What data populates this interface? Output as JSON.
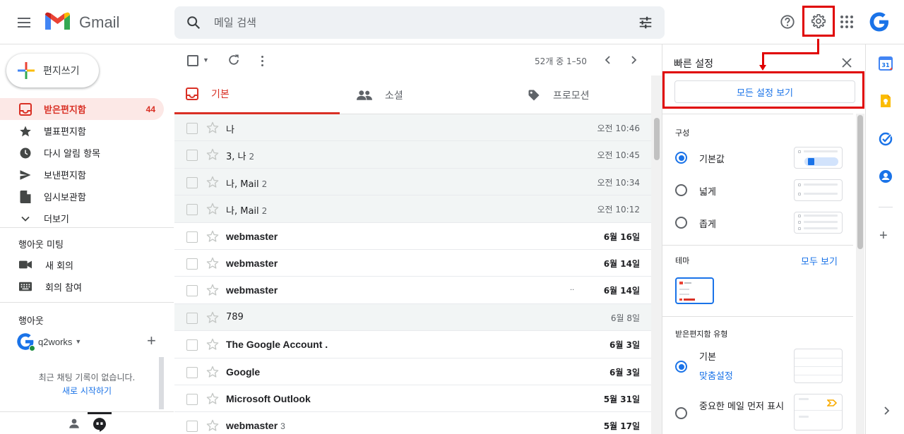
{
  "header": {
    "logo_text": "Gmail",
    "search_placeholder": "메일 검색",
    "account_letter": "G"
  },
  "sidebar": {
    "compose_label": "편지쓰기",
    "nav": [
      {
        "label": "받은편지함",
        "count": "44",
        "icon": "inbox-icon"
      },
      {
        "label": "별표편지함",
        "count": "",
        "icon": "star-icon"
      },
      {
        "label": "다시 알림 항목",
        "count": "",
        "icon": "clock-icon"
      },
      {
        "label": "보낸편지함",
        "count": "",
        "icon": "send-icon"
      },
      {
        "label": "임시보관함",
        "count": "",
        "icon": "draft-icon"
      },
      {
        "label": "더보기",
        "count": "",
        "icon": "chevron-down-icon"
      }
    ],
    "meet": {
      "title": "행아웃 미팅",
      "new_meeting": "새 회의",
      "join_meeting": "회의 참여"
    },
    "hangouts": {
      "title": "행아웃",
      "user": "q2works",
      "empty_text": "최근 채팅 기록이 없습니다.",
      "start_link": "새로 시작하기"
    }
  },
  "toolbar": {
    "page_count": "52개 중 1–50"
  },
  "tabs": [
    {
      "label": "기본",
      "active": true
    },
    {
      "label": "소셜",
      "active": false
    },
    {
      "label": "프로모션",
      "active": false
    }
  ],
  "mails": [
    {
      "sender": "나",
      "count": "",
      "date": "오전 10:46",
      "read": true,
      "snippet": ""
    },
    {
      "sender": "3, 나",
      "count": "2",
      "date": "오전 10:45",
      "read": true,
      "snippet": ""
    },
    {
      "sender": "나, Mail",
      "count": "2",
      "date": "오전 10:34",
      "read": true,
      "snippet": ""
    },
    {
      "sender": "나, Mail",
      "count": "2",
      "date": "오전 10:12",
      "read": true,
      "snippet": ""
    },
    {
      "sender": "webmaster",
      "count": "",
      "date": "6월 16일",
      "read": false,
      "snippet": ""
    },
    {
      "sender": "webmaster",
      "count": "",
      "date": "6월 14일",
      "read": false,
      "snippet": ""
    },
    {
      "sender": "webmaster",
      "count": "",
      "date": "6월 14일",
      "read": false,
      "snippet": ".."
    },
    {
      "sender": "789",
      "count": "",
      "date": "6월 8일",
      "read": true,
      "snippet": ""
    },
    {
      "sender": "The Google Account .",
      "count": "",
      "date": "6월 3일",
      "read": false,
      "snippet": ""
    },
    {
      "sender": "Google",
      "count": "",
      "date": "6월 3일",
      "read": false,
      "snippet": ""
    },
    {
      "sender": "Microsoft Outlook",
      "count": "",
      "date": "5월 31일",
      "read": false,
      "snippet": ""
    },
    {
      "sender": "webmaster",
      "count": "3",
      "date": "5월 17일",
      "read": false,
      "snippet": ""
    }
  ],
  "quick_settings": {
    "title": "빠른 설정",
    "see_all": "모든 설정 보기",
    "density_title": "구성",
    "density_options": [
      "기본값",
      "넓게",
      "좁게"
    ],
    "density_selected": 0,
    "theme_title": "테마",
    "theme_link": "모두 보기",
    "inbox_type_title": "받은편지함 유형",
    "inbox_options": [
      "기본",
      "중요한 메일 먼저 표시"
    ],
    "inbox_custom_link": "맞춤설정",
    "inbox_selected": 0
  },
  "colors": {
    "accent_red": "#d93025",
    "link_blue": "#1a73e8",
    "annotation_red": "#e00000"
  }
}
